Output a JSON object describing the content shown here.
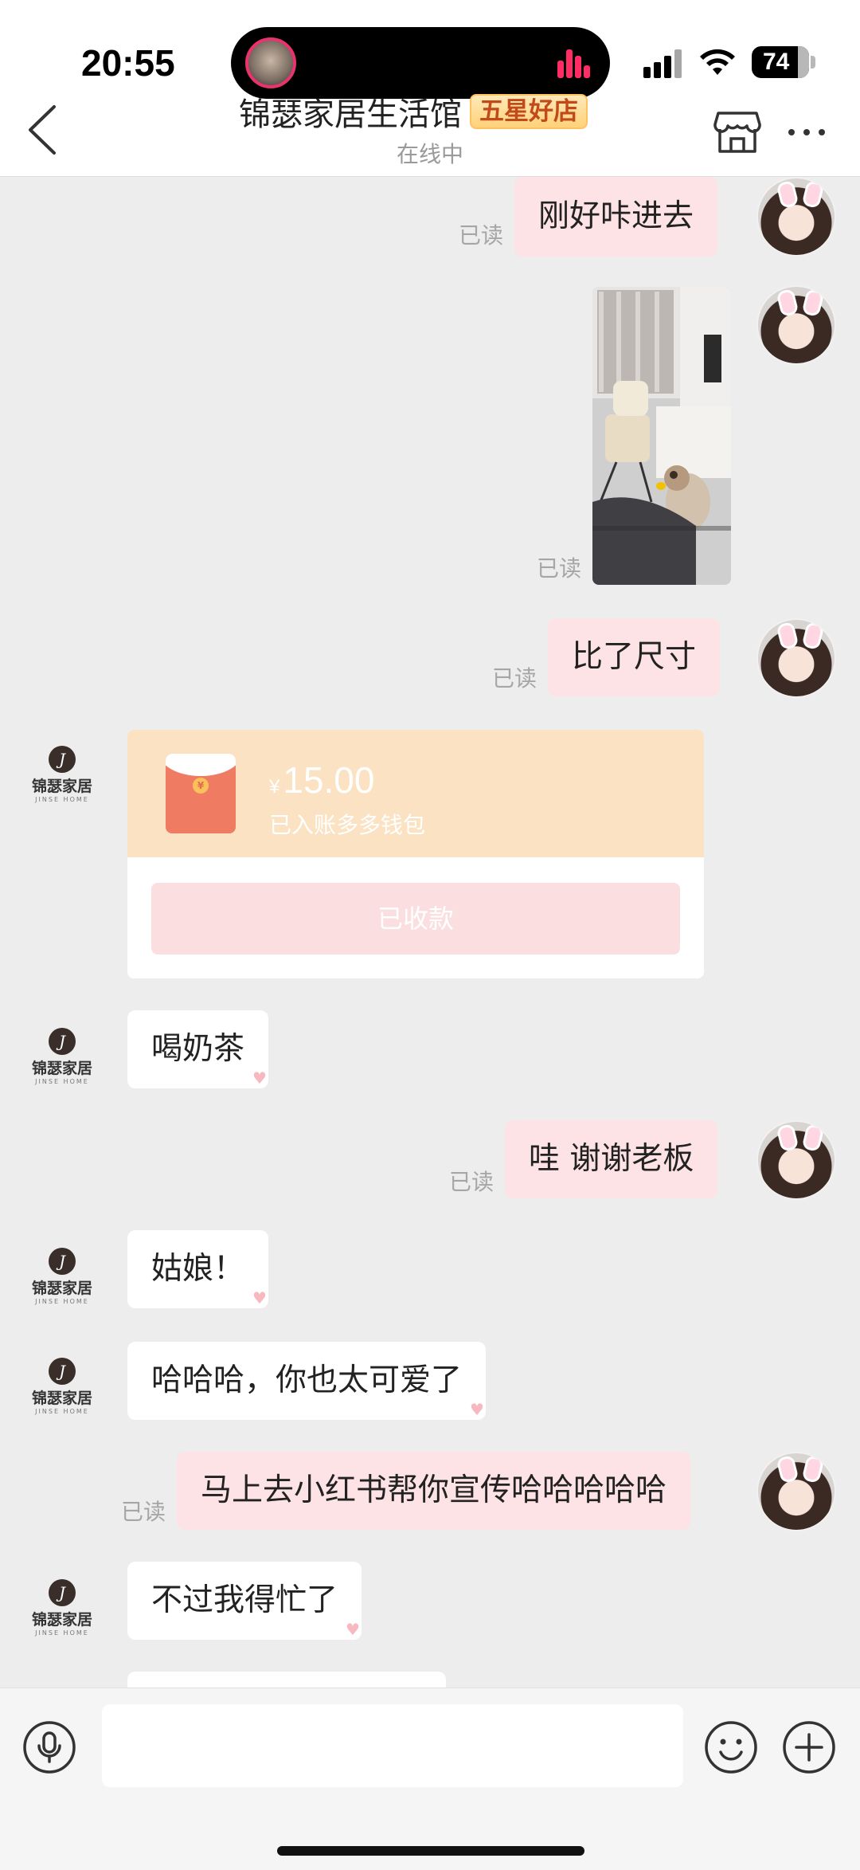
{
  "status_bar": {
    "time": "20:55",
    "battery": "74"
  },
  "header": {
    "title": "锦瑟家居生活馆",
    "badge": "五星好店",
    "subtitle": "在线中",
    "back_icon": "chevron-left-icon",
    "store_icon": "store-icon",
    "more_icon": "more-horizontal-icon"
  },
  "shop_avatar": {
    "mark": "J",
    "name": "锦瑟家居",
    "sub": "JINSE HOME"
  },
  "messages": [
    {
      "side": "out",
      "type": "text",
      "text": "刚好咔进去",
      "read": "已读"
    },
    {
      "side": "out",
      "type": "image",
      "read": "已读"
    },
    {
      "side": "out",
      "type": "text",
      "text": "比了尺寸",
      "read": "已读"
    },
    {
      "side": "in",
      "type": "red_packet",
      "currency": "¥",
      "amount": "15.00",
      "note": "已入账多多钱包",
      "status": "已收款"
    },
    {
      "side": "in",
      "type": "text",
      "text": "喝奶茶"
    },
    {
      "side": "out",
      "type": "text",
      "text": "哇 谢谢老板",
      "read": "已读"
    },
    {
      "side": "in",
      "type": "text",
      "text": "姑娘！"
    },
    {
      "side": "in",
      "type": "text",
      "text": "哈哈哈，你也太可爱了"
    },
    {
      "side": "out",
      "type": "text",
      "text": "马上去小红书帮你宣传哈哈哈哈哈",
      "read": "已读"
    },
    {
      "side": "in",
      "type": "text",
      "text": "不过我得忙了"
    }
  ],
  "input_bar": {
    "placeholder": "",
    "voice_icon": "microphone-icon",
    "emoji_icon": "emoji-icon",
    "plus_icon": "plus-circle-icon"
  },
  "colors": {
    "bubble_out": "#fde3e5",
    "bubble_in": "#ffffff",
    "chat_bg": "#ededed",
    "red_packet_top": "#fae2c2",
    "red_packet_button": "#fbdfe0",
    "badge_text": "#c2491a"
  }
}
